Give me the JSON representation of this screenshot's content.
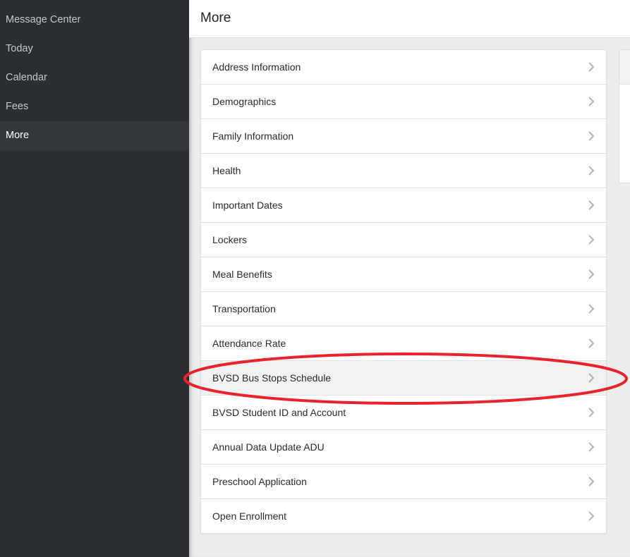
{
  "sidebar": {
    "items": [
      {
        "label": "Message Center",
        "active": false
      },
      {
        "label": "Today",
        "active": false
      },
      {
        "label": "Calendar",
        "active": false
      },
      {
        "label": "Fees",
        "active": false
      },
      {
        "label": "More",
        "active": true
      }
    ]
  },
  "header": {
    "title": "More"
  },
  "list": {
    "items": [
      {
        "label": "Address Information",
        "icon": "chevron-right-icon"
      },
      {
        "label": "Demographics",
        "icon": "chevron-right-icon"
      },
      {
        "label": "Family Information",
        "icon": "chevron-right-icon"
      },
      {
        "label": "Health",
        "icon": "chevron-right-icon"
      },
      {
        "label": "Important Dates",
        "icon": "chevron-right-icon"
      },
      {
        "label": "Lockers",
        "icon": "chevron-right-icon"
      },
      {
        "label": "Meal Benefits",
        "icon": "chevron-right-icon"
      },
      {
        "label": "Transportation",
        "icon": "chevron-right-icon"
      },
      {
        "label": "Attendance Rate",
        "icon": "chevron-right-icon"
      },
      {
        "label": "BVSD Bus Stops Schedule",
        "icon": "chevron-right-icon",
        "highlighted": true
      },
      {
        "label": "BVSD Student ID and Account",
        "icon": "chevron-right-icon"
      },
      {
        "label": "Annual Data Update ADU",
        "icon": "chevron-right-icon"
      },
      {
        "label": "Preschool Application",
        "icon": "chevron-right-icon"
      },
      {
        "label": "Open Enrollment",
        "icon": "chevron-right-icon"
      }
    ]
  },
  "colors": {
    "sidebar_bg": "#2a2e32",
    "sidebar_active_bg": "#33373b",
    "annotation_red": "#e8232b",
    "chevron": "#b5b5b5"
  },
  "annotation": {
    "type": "ellipse",
    "target": "BVSD Bus Stops Schedule"
  }
}
